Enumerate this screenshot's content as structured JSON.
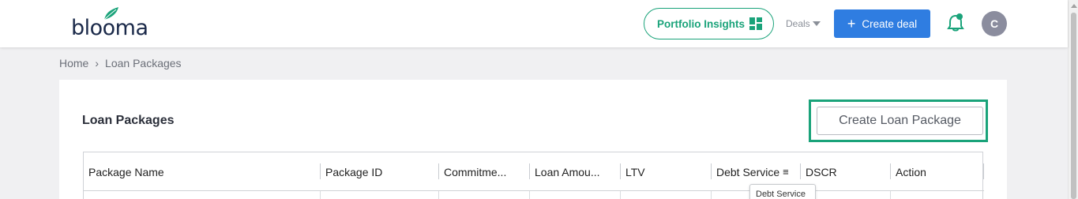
{
  "header": {
    "logo_text": "blooma",
    "brand_color": "#1aa37a",
    "portfolio_insights_label": "Portfolio Insights",
    "deals_label": "Deals",
    "create_deal_label": "Create deal",
    "create_deal_color": "#2f7de1",
    "avatar_initial": "C",
    "icons": [
      "leaf-icon",
      "grid-icon",
      "chevron-down-icon",
      "plus-icon",
      "bell-icon"
    ]
  },
  "breadcrumb": {
    "home": "Home",
    "current": "Loan Packages"
  },
  "page": {
    "title": "Loan Packages",
    "create_button_label": "Create Loan Package"
  },
  "table": {
    "columns": [
      {
        "label": "Package Name"
      },
      {
        "label": "Package ID"
      },
      {
        "label": "Commitme..."
      },
      {
        "label": "Loan Amou..."
      },
      {
        "label": "LTV"
      },
      {
        "label": "Debt Service"
      },
      {
        "label": "DSCR"
      },
      {
        "label": "Action"
      }
    ],
    "tooltip": "Debt Service"
  }
}
